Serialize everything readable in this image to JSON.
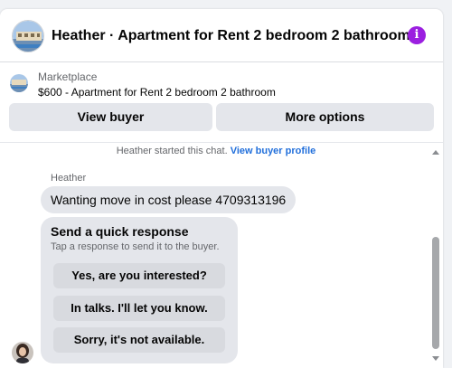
{
  "header": {
    "title": "Heather · Apartment for Rent 2 bedroom 2 bathroom",
    "info_icon": "info-icon",
    "accent_color": "#9b1fe0"
  },
  "listing": {
    "source": "Marketplace",
    "name": "$600 - Apartment for Rent 2 bedroom 2 bathroom",
    "view_buyer_label": "View buyer",
    "more_options_label": "More options"
  },
  "chat": {
    "started_text": "Heather started this chat.",
    "view_profile_link": "View buyer profile",
    "sender_name": "Heather",
    "message": "Wanting move in cost please 4709313196",
    "quick_response": {
      "title": "Send a quick response",
      "subtitle": "Tap a response to send it to the buyer.",
      "options": [
        "Yes, are you interested?",
        "In talks. I'll let you know.",
        "Sorry, it's not available."
      ]
    }
  },
  "colors": {
    "link": "#216fdb",
    "bubble": "#e4e6eb"
  }
}
